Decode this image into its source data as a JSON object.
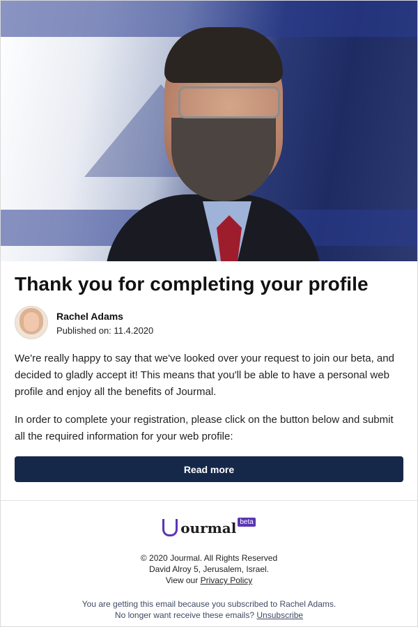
{
  "article": {
    "title": "Thank you for completing your profile",
    "author_name": "Rachel Adams",
    "published_on": "Published on: 11.4.2020",
    "paragraph_1": "We're really happy to say that we've looked over your request to join our beta, and decided to gladly accept it! This means that you'll be able to have a personal web profile and enjoy all the benefits of Jourmal.",
    "paragraph_2": "In order to complete your registration, please click on the button below and submit all the required information for your web profile:",
    "cta_label": "Read more"
  },
  "footer": {
    "logo_text": "ourmal",
    "logo_badge": "beta",
    "copyright": "© 2020 Jourmal. All Rights Reserved",
    "address": "David Alroy 5, Jerusalem, Israel.",
    "privacy_prefix": "View our",
    "privacy_link": "Privacy Policy",
    "subscribed_text": "You are getting this email because you subscribed to Rachel Adams.",
    "unsub_prefix": "No longer want receive these emails?",
    "unsub_link": "Unsubscribe"
  },
  "colors": {
    "button_bg": "#16284a",
    "brand_purple": "#5a35b3"
  },
  "icons": {
    "logo": "jourmal-logo-icon"
  }
}
